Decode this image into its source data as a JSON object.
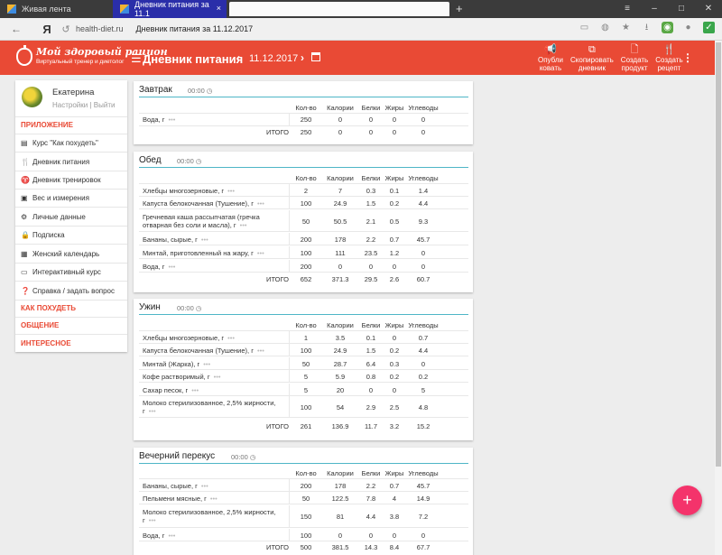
{
  "browser": {
    "tab1": "Живая лента",
    "tab2": "Дневник питания за 11.1",
    "newtab": "+",
    "close": "×",
    "domain": "health-diet.ru",
    "page_title": "Дневник питания за 11.12.2017"
  },
  "app": {
    "logo_line1": "Мой здоровый рацион",
    "logo_line2": "Виртуальный тренер и диетолог",
    "title": "Дневник питания",
    "date": "11.12.2017",
    "actions": [
      {
        "l1": "Опубли",
        "l2": "ковать"
      },
      {
        "l1": "Скопировать",
        "l2": "дневник"
      },
      {
        "l1": "Создать",
        "l2": "продукт"
      },
      {
        "l1": "Создать",
        "l2": "рецепт"
      }
    ]
  },
  "sidebar": {
    "user": "Екатерина",
    "settings": "Настройки",
    "sep": "|",
    "logout": "Выйти",
    "sections": [
      "ПРИЛОЖЕНИЕ",
      "КАК ПОХУДЕТЬ",
      "ОБЩЕНИЕ",
      "ИНТЕРЕСНОЕ"
    ],
    "items": [
      "Курс \"Как похудеть\"",
      "Дневник питания",
      "Дневник тренировок",
      "Вес и измерения",
      "Личные данные",
      "Подписка",
      "Женский календарь",
      "Интерактивный курс",
      "Справка / задать вопрос"
    ]
  },
  "table_headers": [
    "Кол-во",
    "Калории",
    "Белки",
    "Жиры",
    "Углеводы"
  ],
  "total_label": "ИТОГО",
  "meals": [
    {
      "name": "Завтрак",
      "time": "00:00",
      "rows": [
        {
          "name": "Вода, г",
          "qty": "250",
          "kcal": "0",
          "p": "0",
          "f": "0",
          "c": "0"
        }
      ],
      "total": {
        "qty": "250",
        "kcal": "0",
        "p": "0",
        "f": "0",
        "c": "0"
      }
    },
    {
      "name": "Обед",
      "time": "00:00",
      "rows": [
        {
          "name": "Хлебцы многозерновые, г",
          "qty": "2",
          "kcal": "7",
          "p": "0.3",
          "f": "0.1",
          "c": "1.4"
        },
        {
          "name": "Капуста белокочанная (Тушение), г",
          "qty": "100",
          "kcal": "24.9",
          "p": "1.5",
          "f": "0.2",
          "c": "4.4"
        },
        {
          "name": "Гречневая каша рассыпчатая (гречка",
          "name2": "отварная без соли и масла), г",
          "qty": "50",
          "kcal": "50.5",
          "p": "2.1",
          "f": "0.5",
          "c": "9.3"
        },
        {
          "name": "Бананы, сырые, г",
          "qty": "200",
          "kcal": "178",
          "p": "2.2",
          "f": "0.7",
          "c": "45.7"
        },
        {
          "name": "Минтай, приготовленный на жару, г",
          "qty": "100",
          "kcal": "111",
          "p": "23.5",
          "f": "1.2",
          "c": "0"
        },
        {
          "name": "Вода, г",
          "qty": "200",
          "kcal": "0",
          "p": "0",
          "f": "0",
          "c": "0"
        }
      ],
      "total": {
        "qty": "652",
        "kcal": "371.3",
        "p": "29.5",
        "f": "2.6",
        "c": "60.7"
      }
    },
    {
      "name": "Ужин",
      "time": "00:00",
      "rows": [
        {
          "name": "Хлебцы многозерновые, г",
          "qty": "1",
          "kcal": "3.5",
          "p": "0.1",
          "f": "0",
          "c": "0.7"
        },
        {
          "name": "Капуста белокочанная (Тушение), г",
          "qty": "100",
          "kcal": "24.9",
          "p": "1.5",
          "f": "0.2",
          "c": "4.4"
        },
        {
          "name": "Минтай (Жарка), г",
          "qty": "50",
          "kcal": "28.7",
          "p": "6.4",
          "f": "0.3",
          "c": "0"
        },
        {
          "name": "Кофе растворимый, г",
          "qty": "5",
          "kcal": "5.9",
          "p": "0.8",
          "f": "0.2",
          "c": "0.2"
        },
        {
          "name": "Сахар песок, г",
          "qty": "5",
          "kcal": "20",
          "p": "0",
          "f": "0",
          "c": "5"
        },
        {
          "name": "Молоко стерилизованное, 2,5% жирности, г",
          "qty": "100",
          "kcal": "54",
          "p": "2.9",
          "f": "2.5",
          "c": "4.8"
        }
      ],
      "total": {
        "qty": "261",
        "kcal": "136.9",
        "p": "11.7",
        "f": "3.2",
        "c": "15.2"
      }
    },
    {
      "name": "Вечерний перекус",
      "time": "00:00",
      "rows": [
        {
          "name": "Бананы, сырые, г",
          "qty": "200",
          "kcal": "178",
          "p": "2.2",
          "f": "0.7",
          "c": "45.7"
        },
        {
          "name": "Пельмени мясные, г",
          "qty": "50",
          "kcal": "122.5",
          "p": "7.8",
          "f": "4",
          "c": "14.9"
        },
        {
          "name": "Молоко стерилизованное, 2,5% жирности, г",
          "qty": "150",
          "kcal": "81",
          "p": "4.4",
          "f": "3.8",
          "c": "7.2"
        },
        {
          "name": "Вода, г",
          "qty": "100",
          "kcal": "0",
          "p": "0",
          "f": "0",
          "c": "0"
        }
      ],
      "total": {
        "qty": "500",
        "kcal": "381.5",
        "p": "14.3",
        "f": "8.4",
        "c": "67.7"
      }
    }
  ],
  "fab": "+",
  "colors": {
    "brand": "#e94a35",
    "accent_line": "#4fb6c7",
    "fab": "#f4336b"
  }
}
